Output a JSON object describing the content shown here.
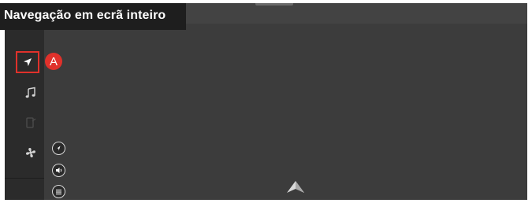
{
  "title": "Navegação em ecrã inteiro",
  "callout_label": "A",
  "colors": {
    "map_background": "#3c3c3c",
    "sidebar": "#2b2b2b",
    "title_bar": "#1e1e1e",
    "highlight": "#e0312b"
  },
  "sidebar": {
    "items": [
      {
        "name": "navigation",
        "icon": "navigation-arrow-icon",
        "selected": true
      },
      {
        "name": "music",
        "icon": "music-note-icon"
      },
      {
        "name": "phone",
        "icon": "phone-icon",
        "disabled": true
      },
      {
        "name": "climate",
        "icon": "fan-icon"
      }
    ]
  },
  "map_controls": [
    {
      "name": "compass",
      "icon": "compass-icon"
    },
    {
      "name": "volume",
      "icon": "volume-icon"
    },
    {
      "name": "menu",
      "icon": "menu-icon"
    }
  ],
  "vehicle_marker": "vehicle-position-icon"
}
